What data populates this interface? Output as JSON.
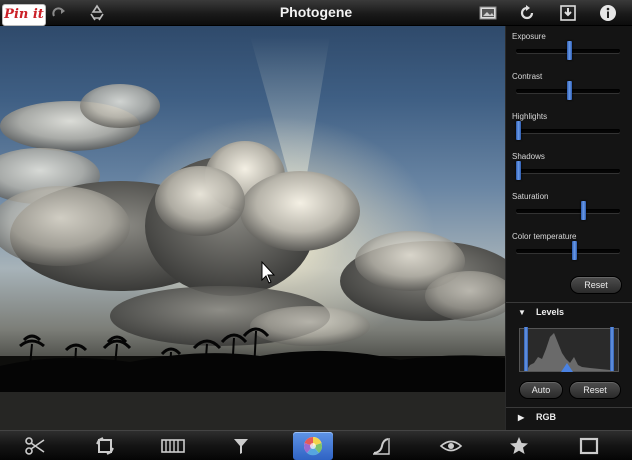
{
  "app": {
    "title": "Photogene"
  },
  "pin_button": {
    "label": "Pin it",
    "brand_color": "#cb2027"
  },
  "topbar": {
    "left_icons": [
      "undo-icon",
      "redo-icon",
      "recycle-icon"
    ],
    "right_icons": [
      "image-icon",
      "refresh-icon",
      "save-icon",
      "info-icon"
    ]
  },
  "adjustments": [
    {
      "label": "Exposure",
      "value": 0.52
    },
    {
      "label": "Contrast",
      "value": 0.52
    },
    {
      "label": "Highlights",
      "value": 0.0
    },
    {
      "label": "Shadows",
      "value": 0.0
    },
    {
      "label": "Saturation",
      "value": 0.66
    },
    {
      "label": "Color temperature",
      "value": 0.57
    }
  ],
  "reset_label": "Reset",
  "levels": {
    "title": "Levels",
    "auto_label": "Auto",
    "reset_label": "Reset",
    "left_handle": 0.06,
    "mid_handle": 0.48,
    "right_handle": 0.94
  },
  "rgb": {
    "title": "RGB"
  },
  "bottom_tools": [
    "crop-icon",
    "rotate-icon",
    "straighten-icon",
    "filter-icon",
    "color-wheel-icon",
    "curves-icon",
    "redeye-icon",
    "star-icon",
    "frame-icon"
  ],
  "active_tool": "color-wheel-icon",
  "accent_color": "#3b73d8"
}
